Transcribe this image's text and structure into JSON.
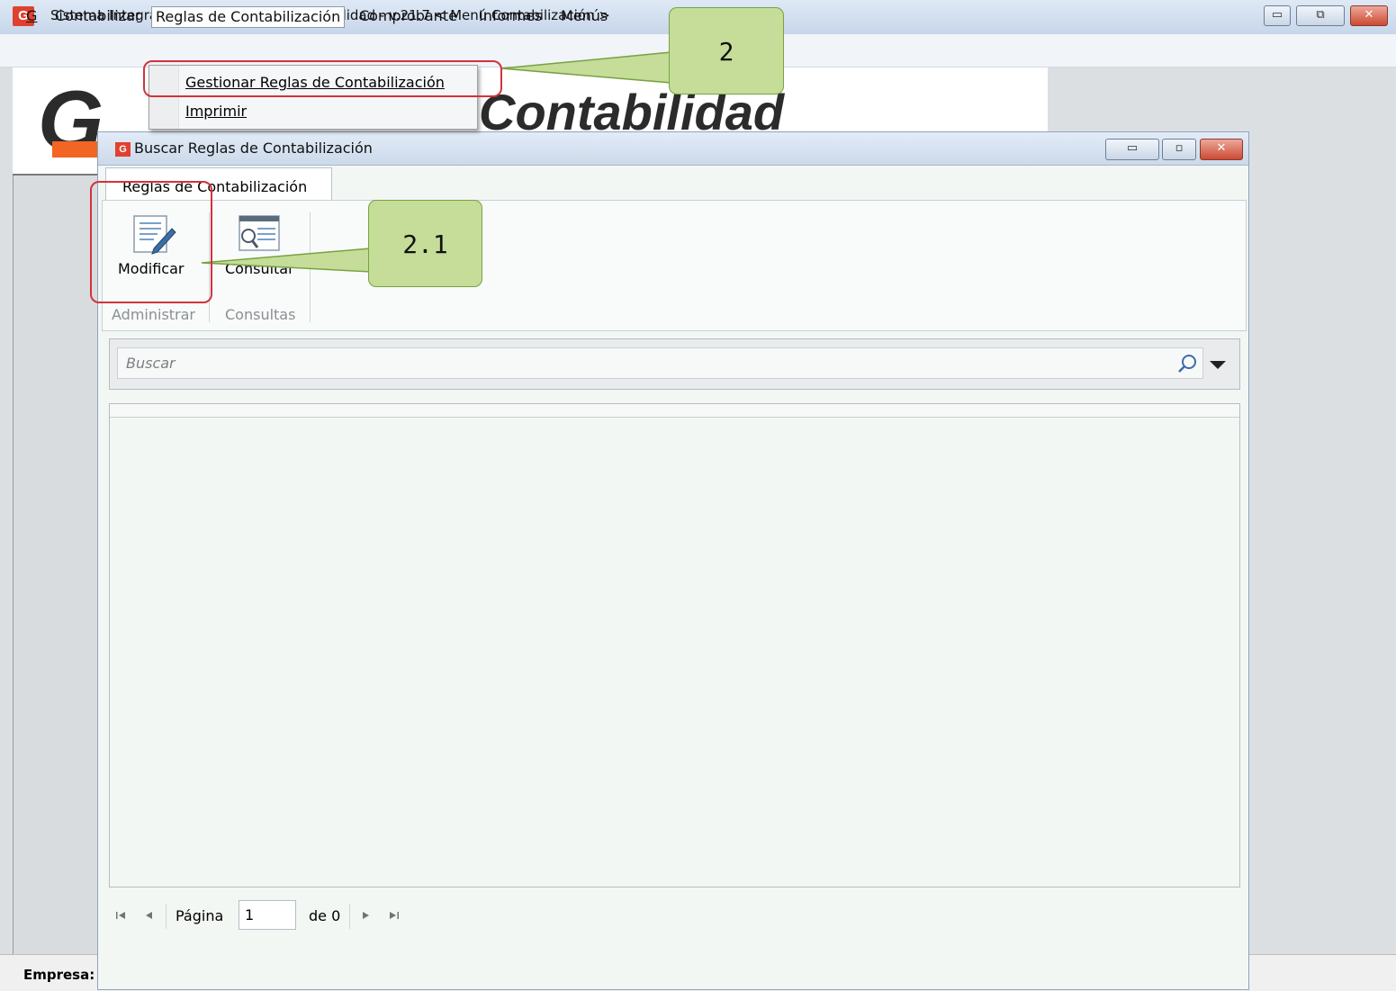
{
  "window": {
    "title": "Sistema Integrado Administrativo - Contabilidad - v.21.7 < Menú Contabilización >",
    "app_icon": "G",
    "controls": [
      "minimize-icon",
      "restore-icon",
      "close-icon"
    ]
  },
  "menubar": {
    "items": [
      {
        "label": "G",
        "accel": "G"
      },
      {
        "label": "Contabilizar",
        "accel": "C"
      },
      {
        "label": "Reglas de Contabilización",
        "accel": "e"
      },
      {
        "label": "Comprobante",
        "accel": "o"
      },
      {
        "label": "Informes",
        "accel": "I"
      },
      {
        "label": "Menús",
        "accel": "M"
      }
    ],
    "open_index": 2
  },
  "dropdown": {
    "items": [
      {
        "label": "Gestionar Reglas de Contabilización"
      },
      {
        "label": "Imprimir"
      }
    ]
  },
  "background": {
    "logo_text": "Contabilidad",
    "status_label": "Empresa:"
  },
  "child_window": {
    "title": "Buscar Reglas de Contabilización",
    "app_icon": "G",
    "tab_label": "Reglas de Contabilización",
    "ribbon": {
      "buttons": [
        {
          "label": "Modificar",
          "icon": "edit-document-icon",
          "group": "Administrar"
        },
        {
          "label": "Consultar",
          "icon": "view-document-icon",
          "group": "Consultas"
        }
      ],
      "groups": [
        "Administrar",
        "Consultas"
      ]
    },
    "search": {
      "placeholder": "Buscar"
    },
    "pager": {
      "page_label": "Página",
      "page_value": "1",
      "of_label": "de 0"
    }
  },
  "annotations": {
    "callout_1": "2",
    "callout_2": "2.1"
  },
  "colors": {
    "callout_fill": "#c5dd99",
    "callout_border": "#78a243",
    "highlight_red": "#d2333b",
    "brand_orange": "#f26522",
    "brand_red": "#e0412e"
  }
}
